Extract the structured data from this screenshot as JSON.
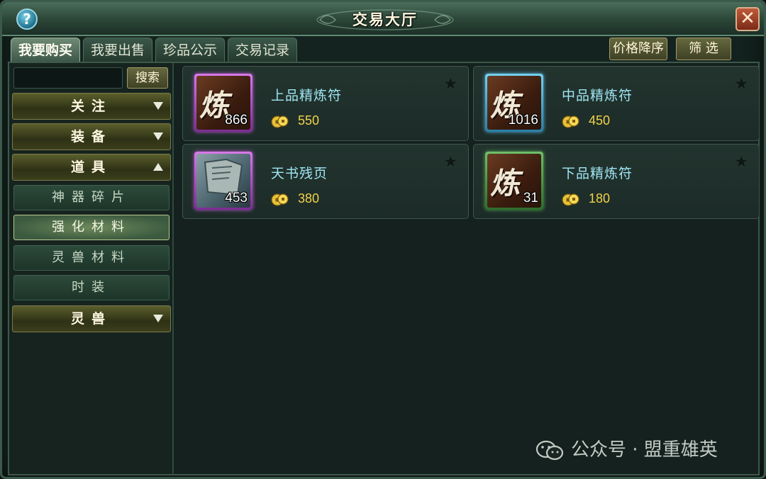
{
  "window": {
    "title": "交易大厅",
    "help_label": "?",
    "close_label": "✕"
  },
  "tabs": [
    {
      "label": "我要购买",
      "active": true
    },
    {
      "label": "我要出售",
      "active": false
    },
    {
      "label": "珍品公示",
      "active": false
    },
    {
      "label": "交易记录",
      "active": false
    }
  ],
  "toolbar": {
    "sort_label": "价格降序",
    "filter_label": "筛 选"
  },
  "search": {
    "placeholder": "",
    "button_label": "搜索"
  },
  "sidebar": {
    "categories": [
      {
        "label": "关注",
        "expanded": false
      },
      {
        "label": "装备",
        "expanded": false
      },
      {
        "label": "道具",
        "expanded": true
      },
      {
        "label": "灵兽",
        "expanded": false
      }
    ],
    "subitems": [
      {
        "label": "神器碎片",
        "active": false
      },
      {
        "label": "强化材料",
        "active": true
      },
      {
        "label": "灵兽材料",
        "active": false
      },
      {
        "label": "时装",
        "active": false
      }
    ]
  },
  "items": [
    {
      "name": "上品精炼符",
      "count": "866",
      "price": "550",
      "rarity": "purple",
      "icon": "refine-talisman-icon"
    },
    {
      "name": "中品精炼符",
      "count": "1016",
      "price": "450",
      "rarity": "blue",
      "icon": "refine-talisman-icon"
    },
    {
      "name": "天书残页",
      "count": "453",
      "price": "380",
      "rarity": "purple",
      "icon": "book-page-icon"
    },
    {
      "name": "下品精炼符",
      "count": "31",
      "price": "180",
      "rarity": "green",
      "icon": "refine-talisman-icon"
    }
  ],
  "watermark": {
    "text": "公众号 · 盟重雄英"
  },
  "colors": {
    "accent_cyan": "#9fe6f2",
    "price_gold": "#f2d24a",
    "rarity_purple": "#d77ae8",
    "rarity_blue": "#74d0f0",
    "rarity_green": "#6fc06a"
  }
}
